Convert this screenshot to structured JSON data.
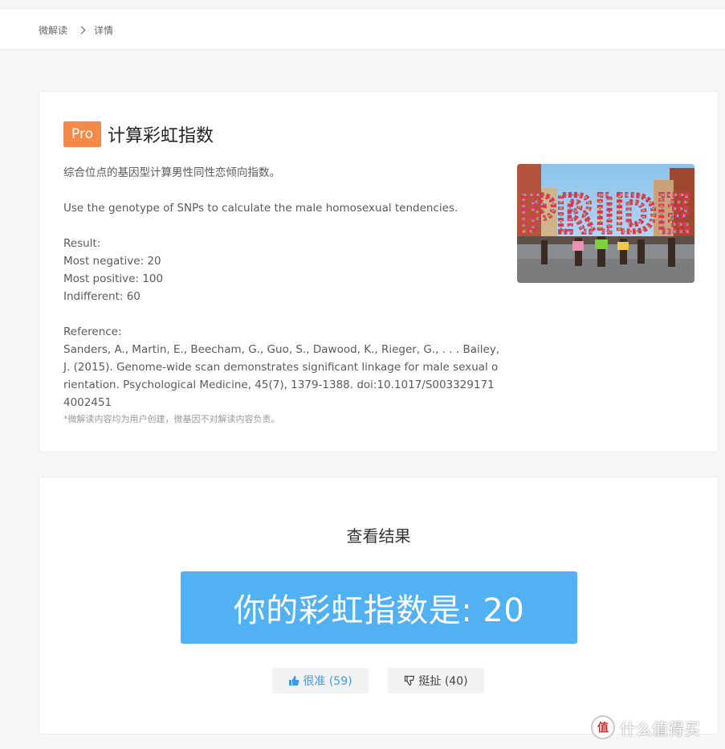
{
  "breadcrumb": {
    "home": "微解读",
    "current": "详情"
  },
  "article": {
    "badge": "Pro",
    "title": "计算彩虹指数",
    "desc_cn": "综合位点的基因型计算男性同性恋倾向指数。",
    "desc_en": "Use the genotype of SNPs to calculate the male homosexual tendencies.",
    "result_label": "Result:",
    "result_items": [
      "Most negative: 20",
      "Most positive: 100",
      "Indifferent: 60"
    ],
    "reference_label": "Reference:",
    "reference_text": "Sanders, A., Martin, E., Beecham, G., Guo, S., Dawood, K., Rieger, G., . . . Bailey, J. (2015). Genome-wide scan demonstrates significant linkage for male sexual orientation. Psychological Medicine, 45(7), 1379-1388. doi:10.1017/S0033291714002451",
    "note": "*微解读内容均为用户创建，微基因不对解读内容负责。",
    "image_text": "PRIDE"
  },
  "result": {
    "heading": "查看结果",
    "value_text": "你的彩虹指数是: 20",
    "upvote_label": "很准 (59)",
    "downvote_label": "挺扯 (40)"
  },
  "watermark": {
    "logo": "值",
    "text": "什么值得买"
  },
  "colors": {
    "accent": "#52b1f3",
    "pro_badge": "#f5894a",
    "upvote": "#3f9ae6"
  }
}
